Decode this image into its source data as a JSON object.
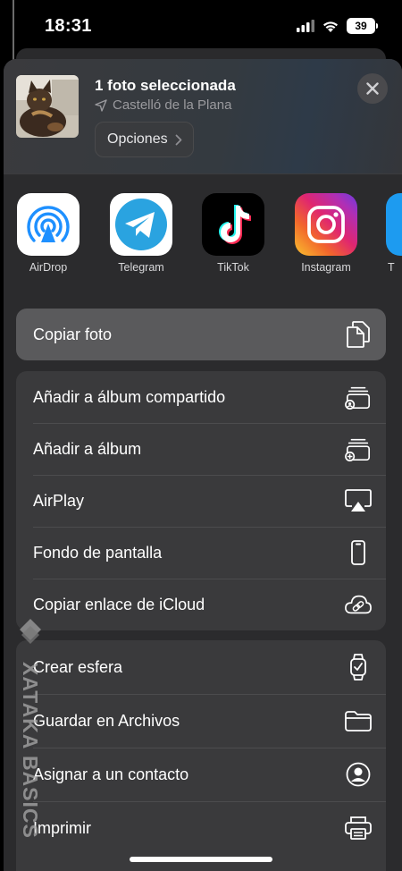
{
  "status": {
    "time": "18:31",
    "battery": "39"
  },
  "header": {
    "title": "1 foto seleccionada",
    "location": "Castelló de la Plana",
    "options_label": "Opciones"
  },
  "apps": [
    {
      "label": "AirDrop",
      "icon": "airdrop-icon"
    },
    {
      "label": "Telegram",
      "icon": "telegram-icon"
    },
    {
      "label": "TikTok",
      "icon": "tiktok-icon"
    },
    {
      "label": "Instagram",
      "icon": "instagram-icon"
    },
    {
      "label": "T",
      "icon": "twitter-icon"
    }
  ],
  "actions": {
    "copy_photo": "Copiar foto",
    "add_shared_album": "Añadir a álbum compartido",
    "add_album": "Añadir a álbum",
    "airplay": "AirPlay",
    "wallpaper": "Fondo de pantalla",
    "copy_icloud_link": "Copiar enlace de iCloud",
    "create_watch_face": "Crear esfera",
    "save_to_files": "Guardar en Archivos",
    "assign_to_contact": "Asignar a un contacto",
    "print": "Imprimir"
  },
  "watermark": "XATAKA BASICS",
  "colors": {
    "sheet": "#2b2b2d",
    "row_group": "#3a3a3c",
    "copy_highlight": "#5a5a5c",
    "telegram": "#2aa3e0",
    "airdrop": "#1e90ff"
  }
}
